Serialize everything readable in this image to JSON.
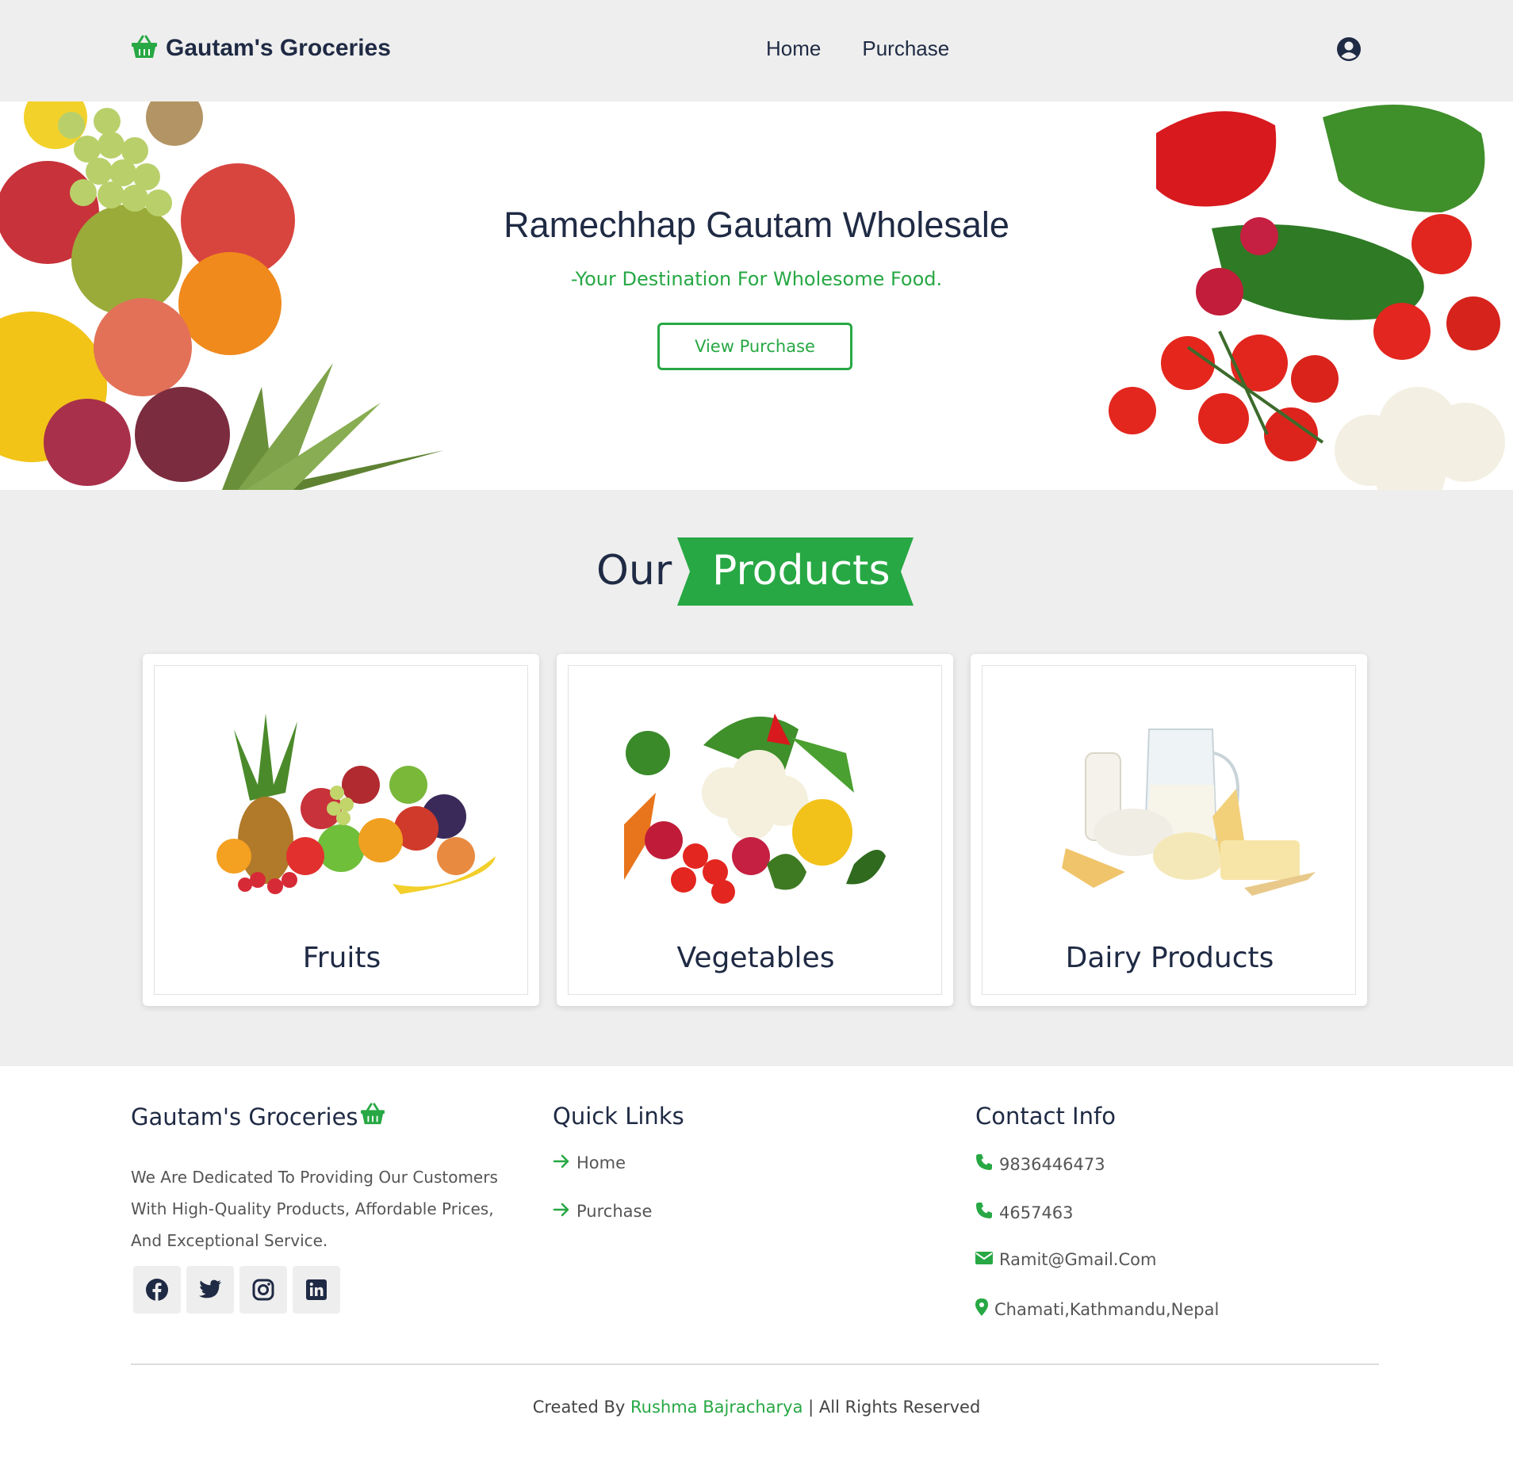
{
  "header": {
    "brand": "Gautam's Groceries",
    "nav": [
      {
        "label": "Home"
      },
      {
        "label": "Purchase"
      }
    ],
    "icons": {
      "logo": "basket-icon",
      "user": "user-circle-icon"
    }
  },
  "hero": {
    "title": "Ramechhap Gautam Wholesale",
    "subtitle": "-Your Destination For Wholesome Food.",
    "button_label": "View Purchase"
  },
  "products": {
    "heading_our": "Our",
    "heading_products": "Products",
    "items": [
      {
        "label": "Fruits"
      },
      {
        "label": "Vegetables"
      },
      {
        "label": "Dairy Products"
      }
    ]
  },
  "footer": {
    "brand": "Gautam's Groceries",
    "description": "We Are Dedicated To Providing Our Customers With High-Quality Products, Affordable Prices, And Exceptional Service.",
    "socials": [
      "facebook-icon",
      "twitter-icon",
      "instagram-icon",
      "linkedin-icon"
    ],
    "quick_links_title": "Quick Links",
    "quick_links": [
      {
        "label": "Home"
      },
      {
        "label": "Purchase"
      }
    ],
    "contact_title": "Contact Info",
    "contacts": {
      "phone1": "9836446473",
      "phone2": "4657463",
      "email": "Ramit@Gmail.Com",
      "address": "Chamati,Kathmandu,Nepal"
    },
    "copyright_prefix": "Created By",
    "copyright_author": "Rushma Bajracharya",
    "copyright_suffix": "| All Rights Reserved"
  },
  "colors": {
    "accent": "#27a844",
    "text_dark": "#1f2a44",
    "background": "#eeeeee"
  }
}
